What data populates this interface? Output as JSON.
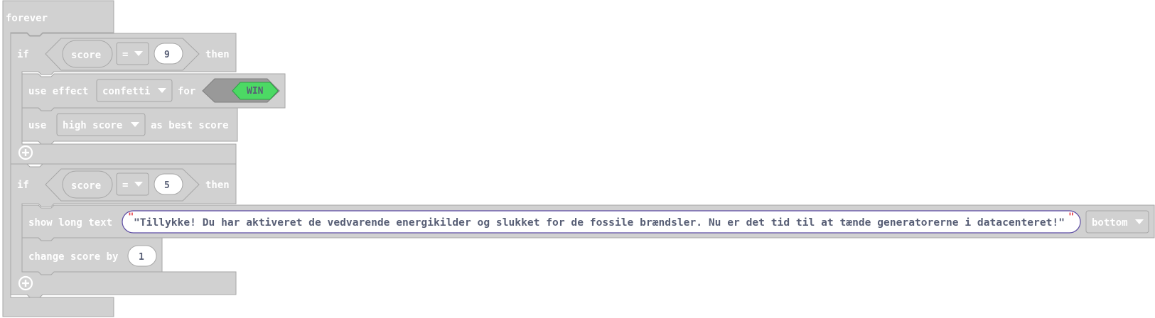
{
  "blocks": {
    "forever_label": "forever",
    "if1": {
      "if_label": "if",
      "variable": "score",
      "operator": "=",
      "value": "9",
      "then_label": "then"
    },
    "use_effect": {
      "use_effect_label": "use effect",
      "effect": "confetti",
      "for_label": "for",
      "result": "WIN"
    },
    "use_best": {
      "use_label": "use",
      "score_type": "high score",
      "as_best_label": "as best score"
    },
    "if2": {
      "if_label": "if",
      "variable": "score",
      "operator": "=",
      "value": "5",
      "then_label": "then"
    },
    "show_long_text": {
      "label": "show long text",
      "open_quote": "\"",
      "text": "\"Tillykke! Du har aktiveret de vedvarende energikilder og slukket for de fossile brændsler. Nu er det tid til at tænde generatorerne i datacenteret!\"",
      "close_quote": "\"",
      "position": "bottom"
    },
    "change_score": {
      "label": "change score by",
      "value": "1"
    }
  },
  "colors": {
    "block_fill": "#d1d1d1",
    "block_stroke": "#a6a6a6",
    "win_green": "#4cd964",
    "dark_text": "#575e75",
    "text_border": "#5b4aa3",
    "quote": "#e9464e"
  }
}
